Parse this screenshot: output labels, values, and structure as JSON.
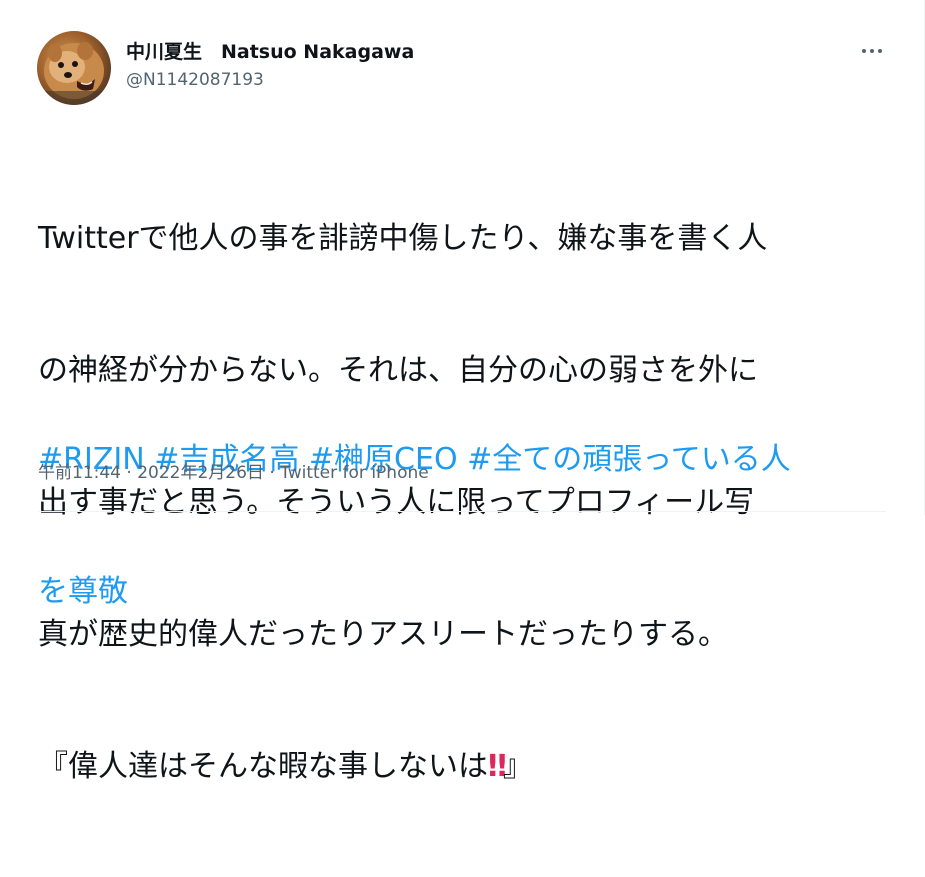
{
  "author": {
    "display_name": "中川夏生　Natsuo Nakagawa",
    "handle": "@N1142087193",
    "avatar_icon": "dog-avatar-icon"
  },
  "tweet": {
    "lines": [
      "Twitterで他人の事を誹謗中傷したり、嫌な事を書く人",
      "の神経が分からない。それは、自分の心の弱さを外に",
      "出す事だと思う。そういう人に限ってプロフィール写",
      "真が歴史的偉人だったりアスリートだったりする。"
    ],
    "quote_line_prefix": "『偉人達はそんな暇な事しないは",
    "quote_line_emoji": "‼",
    "quote_line_suffix": "』",
    "hashtags_line1": [
      "#RIZIN",
      "#吉成名高",
      "#榊原CEO",
      "#全ての頑張っている人"
    ],
    "hashtags_line2": "を尊敬"
  },
  "meta": {
    "time": "午前11:44",
    "date": "2022年2月26日",
    "separator": " · ",
    "source": "Twitter for iPhone"
  },
  "colors": {
    "text": "#0f1419",
    "secondary": "#536471",
    "link": "#1d9bf0",
    "emoji": "#e0245e"
  },
  "icons": {
    "more": "more-options-icon"
  }
}
